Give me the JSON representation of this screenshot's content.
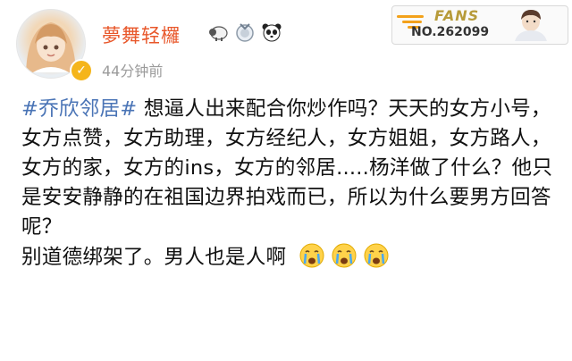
{
  "user": {
    "name": "夢舞轻欏",
    "time": "44分钟前",
    "verified_symbol": "✓",
    "badges": [
      "sheep-badge-icon",
      "medal-badge-icon",
      "panda-badge-icon"
    ]
  },
  "fans_card": {
    "label": "FANS",
    "number": "NO.262099"
  },
  "post": {
    "hashtag": "#乔欣邻居#",
    "text": " 想逼人出来配合你炒作吗？天天的女方小号，女方点赞，女方助理，女方经纪人，女方姐姐，女方路人，女方的家，女方的ins，女方的邻居.....杨洋做了什么？他只是安安静静的在祖国边界拍戏而已，所以为什么要男方回答呢？",
    "line2": "别道德绑架了。男人也是人啊",
    "emojis": [
      "crying-face-icon",
      "crying-face-icon",
      "crying-face-icon"
    ]
  },
  "colors": {
    "username": "#e8572a",
    "hashtag": "#4a74b6",
    "timestamp": "#9b9b9b"
  }
}
